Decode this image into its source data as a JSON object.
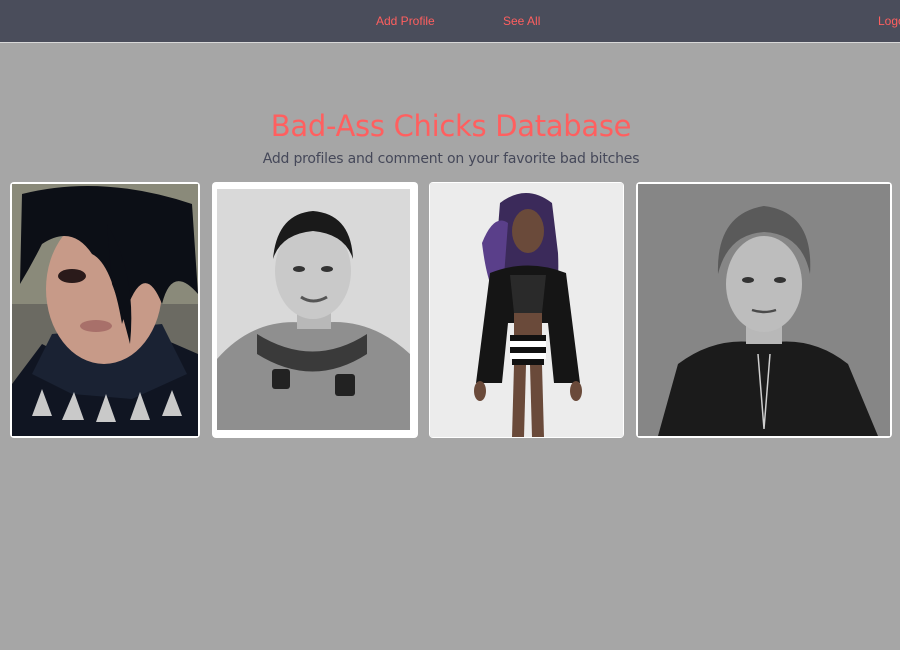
{
  "nav": {
    "add_profile": "Add Profile",
    "see_all": "See All",
    "logout": "Logo"
  },
  "hero": {
    "title": "Bad-Ass Chicks Database",
    "subtitle": "Add profiles and comment on your favorite bad bitches"
  },
  "colors": {
    "accent": "#ff5f5f",
    "nav_bg": "#4a4d5b",
    "page_bg": "#a6a6a6",
    "subtitle": "#454859"
  },
  "profiles": [
    {
      "photo_style": "color"
    },
    {
      "photo_style": "black-and-white"
    },
    {
      "photo_style": "color"
    },
    {
      "photo_style": "black-and-white"
    }
  ]
}
